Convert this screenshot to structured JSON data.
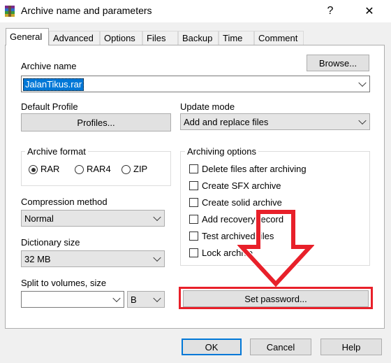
{
  "window": {
    "title": "Archive name and parameters",
    "help_glyph": "?",
    "close_glyph": "✕"
  },
  "tabs": [
    "General",
    "Advanced",
    "Options",
    "Files",
    "Backup",
    "Time",
    "Comment"
  ],
  "archive_name": {
    "label": "Archive name",
    "value": "JalanTikus.rar",
    "browse_label": "Browse..."
  },
  "default_profile": {
    "label": "Default Profile",
    "button_label": "Profiles..."
  },
  "update_mode": {
    "label": "Update mode",
    "value": "Add and replace files"
  },
  "archive_format": {
    "legend": "Archive format",
    "options": [
      "RAR",
      "RAR4",
      "ZIP"
    ],
    "selected": "RAR"
  },
  "archiving_options": {
    "legend": "Archiving options",
    "items": [
      "Delete files after archiving",
      "Create SFX archive",
      "Create solid archive",
      "Add recovery record",
      "Test archived files",
      "Lock archive"
    ]
  },
  "compression_method": {
    "label": "Compression method",
    "value": "Normal"
  },
  "dictionary_size": {
    "label": "Dictionary size",
    "value": "32 MB"
  },
  "split_volumes": {
    "label": "Split to volumes, size",
    "value": "",
    "unit": "B"
  },
  "set_password_label": "Set password...",
  "footer": {
    "ok_label": "OK",
    "cancel_label": "Cancel",
    "help_label": "Help"
  },
  "colors": {
    "accent": "#0078d7",
    "annotation_red": "#e8202a"
  }
}
